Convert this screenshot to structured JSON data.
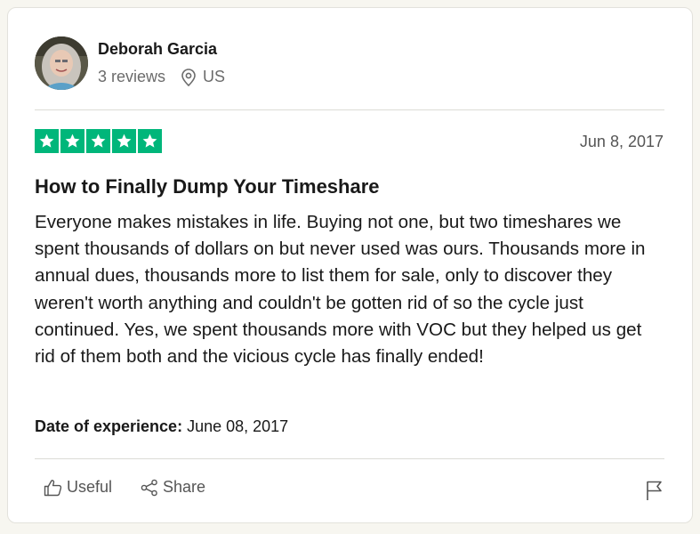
{
  "reviewer": {
    "name": "Deborah Garcia",
    "reviews": "3 reviews",
    "country": "US",
    "avatar_icon": "user-photo",
    "location_icon": "location-pin-icon"
  },
  "review": {
    "rating": 5,
    "max_rating": 5,
    "star_color": "#00b67a",
    "date": "Jun 8, 2017",
    "title": "How to Finally Dump Your Timeshare",
    "body": "Everyone makes mistakes in life. Buying not one, but two timeshares we spent thousands of dollars on but never used was ours. Thousands more in annual dues, thousands more to list them for sale, only to discover they weren't worth anything and couldn't be gotten rid of so the cycle just continued. Yes, we spent thousands more with VOC but they helped us get rid of them both and the vicious cycle has finally ended!",
    "experience_label": "Date of experience:",
    "experience_date": "June 08, 2017"
  },
  "actions": {
    "useful_label": "Useful",
    "share_label": "Share",
    "useful_icon": "thumbs-up-icon",
    "share_icon": "share-icon",
    "flag_icon": "flag-icon"
  }
}
